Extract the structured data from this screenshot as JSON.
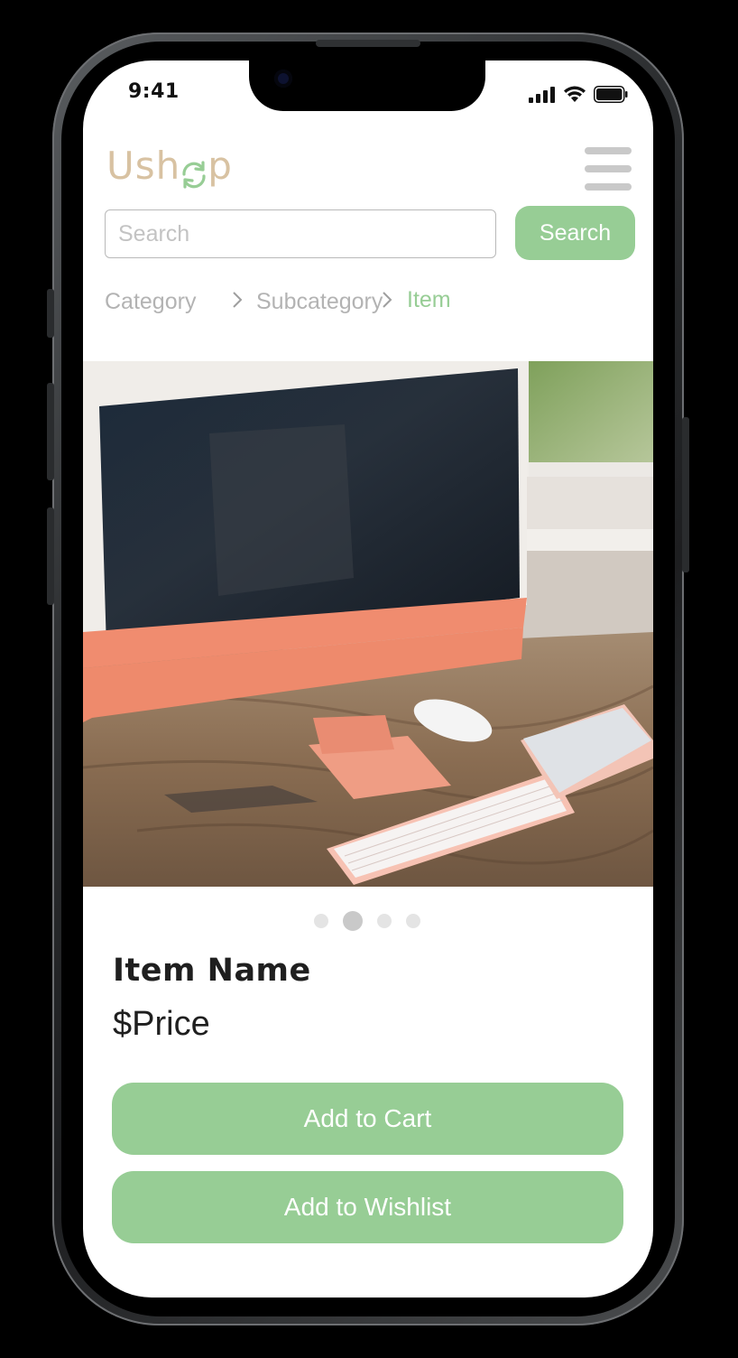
{
  "status_bar": {
    "time": "9:41",
    "icons": [
      "cellular-signal-icon",
      "wifi-icon",
      "battery-icon"
    ]
  },
  "header": {
    "logo_text_before": "Ush",
    "logo_text_after": "p",
    "logo_icon": "recycle-arrows-icon",
    "menu_icon": "hamburger-menu-icon"
  },
  "search": {
    "placeholder": "Search",
    "value": "",
    "button_label": "Search"
  },
  "breadcrumb": {
    "items": [
      "Category",
      "Subcategory",
      "Item"
    ],
    "separator_icon": "chevron-right-icon"
  },
  "product": {
    "image_alt": "Pink iMac desktop computer with keyboard, mouse and trackpad on a wooden desk",
    "carousel": {
      "total": 4,
      "active_index": 1
    },
    "name": "Item Name",
    "price": "$Price"
  },
  "actions": {
    "add_to_cart": "Add to Cart",
    "add_to_wishlist": "Add to Wishlist"
  },
  "colors": {
    "accent": "#97cd95",
    "logo": "#d8c2a2",
    "breadcrumb_active": "#97cd95",
    "breadcrumb_inactive": "#b3b3b3",
    "text": "#1f1f1f"
  }
}
